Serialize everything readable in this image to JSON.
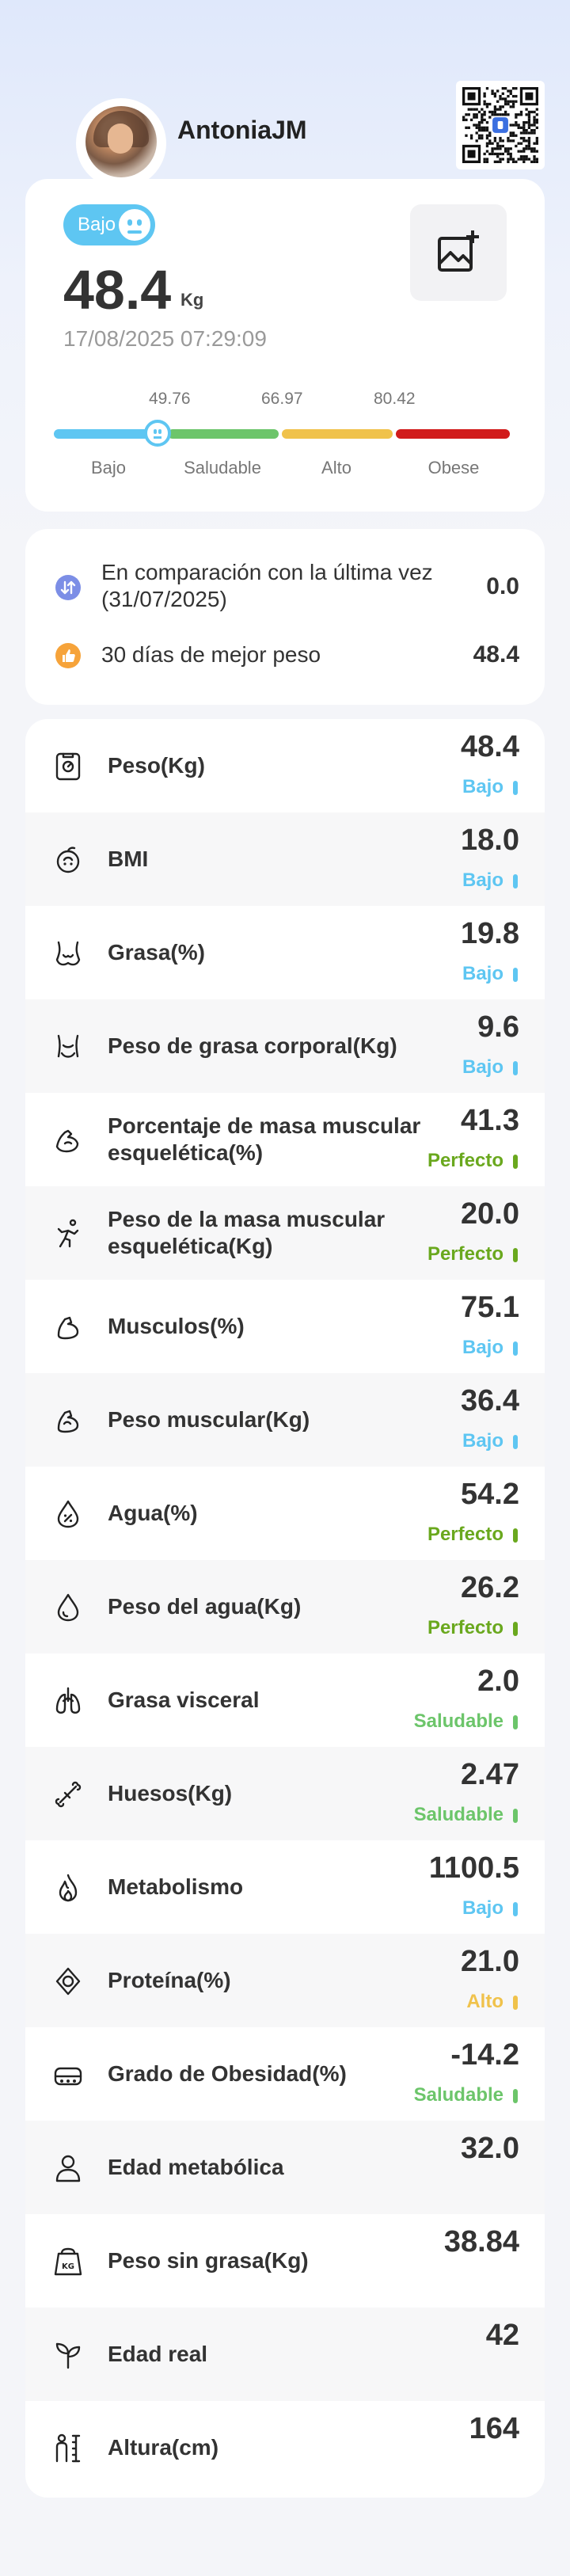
{
  "user": {
    "name": "AntoniaJM"
  },
  "weight_card": {
    "badge": "Bajo",
    "value": "48.4",
    "unit": "Kg",
    "date": "17/08/2025 07:29:09",
    "thresholds": [
      "49.76",
      "66.97",
      "80.42"
    ],
    "categories": [
      "Bajo",
      "Saludable",
      "Alto",
      "Obese"
    ],
    "category_colors": [
      "#5ec6f2",
      "#6cc56a",
      "#f0c24b",
      "#d11b1b"
    ]
  },
  "comparison": {
    "last_label": "En comparación con la última vez (31/07/2025)",
    "last_value": "0.0",
    "best_label": "30 días de mejor peso",
    "best_value": "48.4"
  },
  "colors": {
    "bajo": "#5ec6f2",
    "perfecto": "#6aa81e",
    "saludable": "#6cc56a",
    "alto": "#f0c24b"
  },
  "metrics": [
    {
      "name": "Peso(Kg)",
      "value": "48.4",
      "status": "Bajo",
      "color": "#5ec6f2",
      "icon": "scale-icon"
    },
    {
      "name": "BMI",
      "value": "18.0",
      "status": "Bajo",
      "color": "#5ec6f2",
      "icon": "bmi-icon"
    },
    {
      "name": "Grasa(%)",
      "value": "19.8",
      "status": "Bajo",
      "color": "#5ec6f2",
      "icon": "body-fat-icon"
    },
    {
      "name": "Peso de grasa corporal(Kg)",
      "value": "9.6",
      "status": "Bajo",
      "color": "#5ec6f2",
      "icon": "fat-weight-icon"
    },
    {
      "name": "Porcentaje de masa muscular esquelética(%)",
      "value": "41.3",
      "status": "Perfecto",
      "color": "#6aa81e",
      "icon": "muscle-arm-icon"
    },
    {
      "name": "Peso de la masa muscular esquelética(Kg)",
      "value": "20.0",
      "status": "Perfecto",
      "color": "#6aa81e",
      "icon": "running-icon"
    },
    {
      "name": "Musculos(%)",
      "value": "75.1",
      "status": "Bajo",
      "color": "#5ec6f2",
      "icon": "muscle-icon"
    },
    {
      "name": "Peso muscular(Kg)",
      "value": "36.4",
      "status": "Bajo",
      "color": "#5ec6f2",
      "icon": "muscle-weight-icon"
    },
    {
      "name": "Agua(%)",
      "value": "54.2",
      "status": "Perfecto",
      "color": "#6aa81e",
      "icon": "water-percent-icon"
    },
    {
      "name": "Peso del agua(Kg)",
      "value": "26.2",
      "status": "Perfecto",
      "color": "#6aa81e",
      "icon": "water-drop-icon"
    },
    {
      "name": "Grasa visceral",
      "value": "2.0",
      "status": "Saludable",
      "color": "#6cc56a",
      "icon": "lungs-icon"
    },
    {
      "name": "Huesos(Kg)",
      "value": "2.47",
      "status": "Saludable",
      "color": "#6cc56a",
      "icon": "bone-icon"
    },
    {
      "name": "Metabolismo",
      "value": "1100.5",
      "status": "Bajo",
      "color": "#5ec6f2",
      "icon": "flame-icon"
    },
    {
      "name": "Proteína(%)",
      "value": "21.0",
      "status": "Alto",
      "color": "#f0c24b",
      "icon": "protein-icon"
    },
    {
      "name": "Grado de Obesidad(%)",
      "value": "-14.2",
      "status": "Saludable",
      "color": "#6cc56a",
      "icon": "obesity-icon"
    },
    {
      "name": "Edad metabólica",
      "value": "32.0",
      "status": "",
      "color": "",
      "icon": "person-icon"
    },
    {
      "name": "Peso sin grasa(Kg)",
      "value": "38.84",
      "status": "",
      "color": "",
      "icon": "kg-weight-icon"
    },
    {
      "name": "Edad real",
      "value": "42",
      "status": "",
      "color": "",
      "icon": "sprout-icon"
    },
    {
      "name": "Altura(cm)",
      "value": "164",
      "status": "",
      "color": "",
      "icon": "height-icon"
    }
  ]
}
